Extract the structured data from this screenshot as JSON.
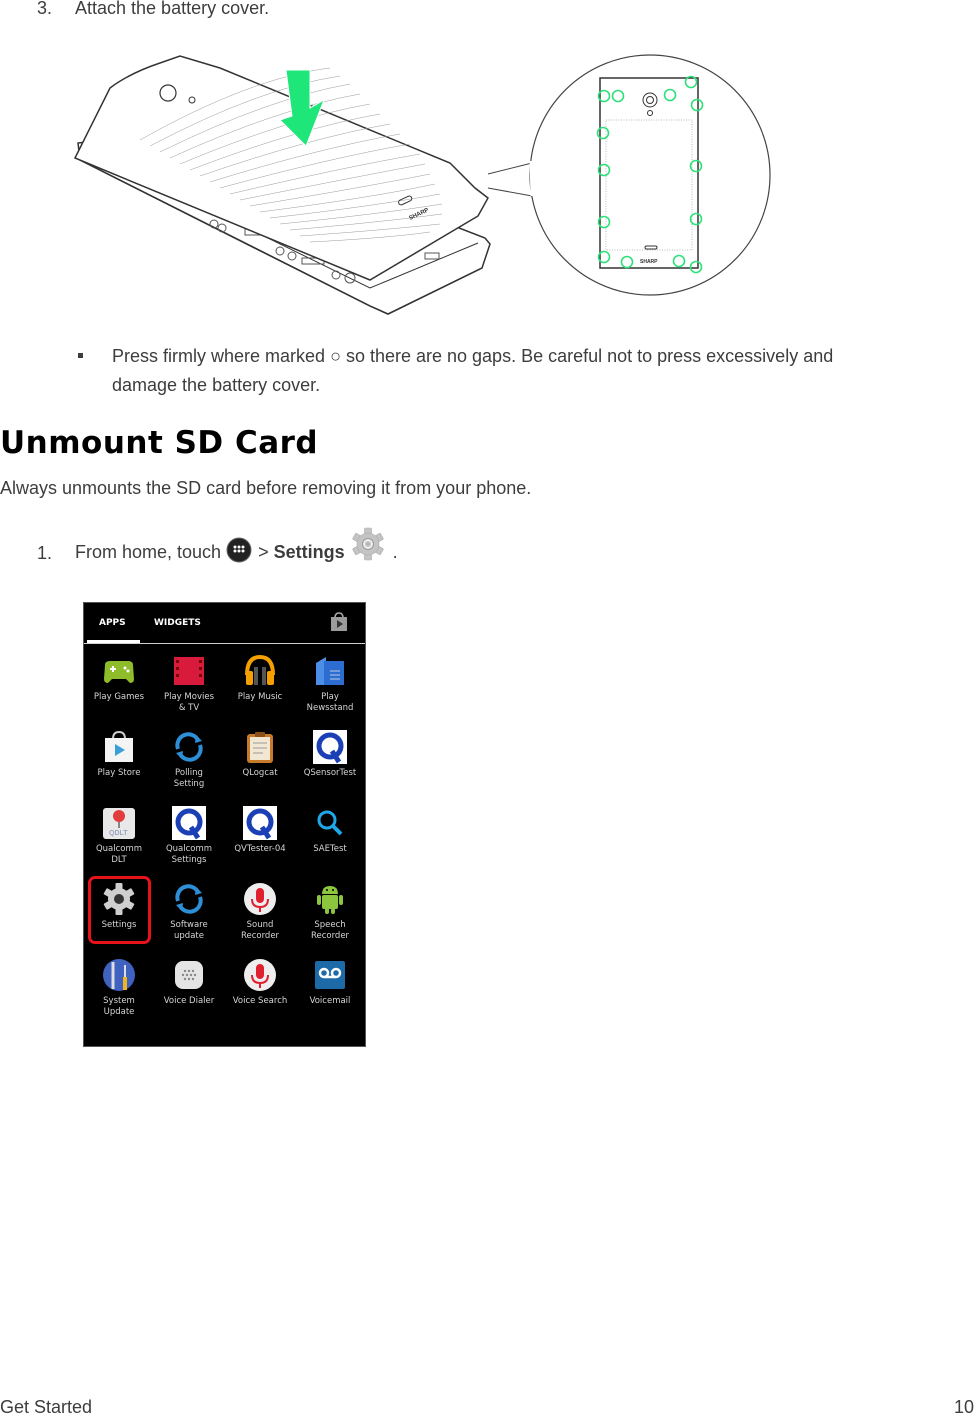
{
  "step3": {
    "number": "3.",
    "text": "Attach the battery cover."
  },
  "illustration": {
    "arrow_color": "#1ee678",
    "marker_color": "#2fe07a",
    "brand_text": "SHARP"
  },
  "note": {
    "text_before": "Press firmly where marked",
    "marker_glyph": "○",
    "text_after": "so there are no gaps. Be careful not to press excessively and",
    "text_line2": "damage the battery cover."
  },
  "section": {
    "title": "Unmount SD Card",
    "intro": "Always unmounts the SD card before removing it from your phone."
  },
  "step1": {
    "number": "1.",
    "prefix": "From home, touch",
    "separator": ">",
    "settings_label": "Settings",
    "suffix": "."
  },
  "drawer": {
    "tabs": [
      {
        "label": "APPS",
        "active": true
      },
      {
        "label": "WIDGETS",
        "active": false
      }
    ],
    "apps": [
      {
        "label": "Play Games",
        "icon": "gamepad-icon"
      },
      {
        "label": "Play Movies\n& TV",
        "icon": "film-icon"
      },
      {
        "label": "Play Music",
        "icon": "headphones-icon"
      },
      {
        "label": "Play\nNewsstand",
        "icon": "newsstand-icon"
      },
      {
        "label": "Play Store",
        "icon": "shopping-bag-icon"
      },
      {
        "label": "Polling\nSetting",
        "icon": "sync-icon"
      },
      {
        "label": "QLogcat",
        "icon": "clipboard-icon"
      },
      {
        "label": "QSensorTest",
        "icon": "qualcomm-q-icon"
      },
      {
        "label": "Qualcomm\nDLT",
        "icon": "pushpin-icon"
      },
      {
        "label": "Qualcomm\nSettings",
        "icon": "qualcomm-q-icon"
      },
      {
        "label": "QVTester-04",
        "icon": "qualcomm-q-icon"
      },
      {
        "label": "SAETest",
        "icon": "magnifier-icon"
      },
      {
        "label": "Settings",
        "icon": "gear-icon",
        "highlighted": true
      },
      {
        "label": "Software\nupdate",
        "icon": "sync-icon"
      },
      {
        "label": "Sound\nRecorder",
        "icon": "microphone-icon"
      },
      {
        "label": "Speech\nRecorder",
        "icon": "android-icon"
      },
      {
        "label": "System\nUpdate",
        "icon": "tools-icon"
      },
      {
        "label": "Voice Dialer",
        "icon": "speaker-grille-icon"
      },
      {
        "label": "Voice Search",
        "icon": "microphone-icon"
      },
      {
        "label": "Voicemail",
        "icon": "voicemail-icon"
      }
    ],
    "highlight_color": "#e8121a"
  },
  "footer": {
    "section": "Get Started",
    "page": "10"
  }
}
